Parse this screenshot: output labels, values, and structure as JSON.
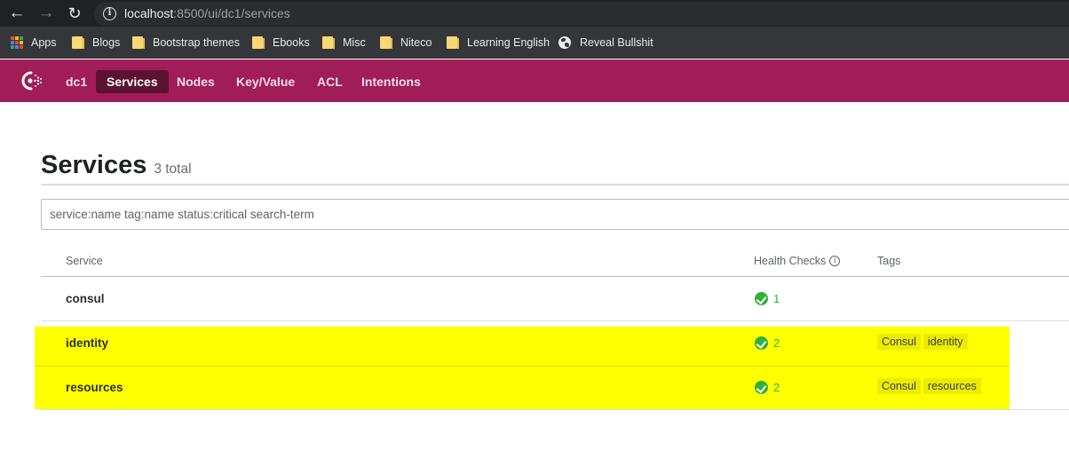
{
  "browser": {
    "url_host": "localhost",
    "url_rest": ":8500/ui/dc1/services",
    "bookmarks": [
      {
        "label": "Apps",
        "icon": "apps-grid-icon"
      },
      {
        "label": "Blogs",
        "icon": "folder-icon"
      },
      {
        "label": "Bootstrap themes",
        "icon": "folder-icon"
      },
      {
        "label": "Ebooks",
        "icon": "folder-icon"
      },
      {
        "label": "Misc",
        "icon": "folder-icon"
      },
      {
        "label": "Niteco",
        "icon": "folder-icon"
      },
      {
        "label": "Learning English",
        "icon": "folder-icon"
      },
      {
        "label": "Reveal Bullshit",
        "icon": "globe-icon"
      }
    ]
  },
  "header": {
    "brand_color": "#a01d58",
    "datacenter": "dc1",
    "nav": [
      {
        "label": "Services",
        "active": true
      },
      {
        "label": "Nodes",
        "active": false
      },
      {
        "label": "Key/Value",
        "active": false
      },
      {
        "label": "ACL",
        "active": false
      },
      {
        "label": "Intentions",
        "active": false
      }
    ]
  },
  "page": {
    "title": "Services",
    "count_label": "3 total",
    "search": {
      "value": "",
      "placeholder": "service:name tag:name status:critical search-term"
    }
  },
  "table": {
    "columns": [
      "Service",
      "Health Checks",
      "Tags"
    ],
    "rows": [
      {
        "service": "consul",
        "health_passing": "1",
        "tags": []
      },
      {
        "service": "identity",
        "health_passing": "2",
        "tags": [
          "Consul",
          "identity"
        ]
      },
      {
        "service": "resources",
        "health_passing": "2",
        "tags": [
          "Consul",
          "resources"
        ]
      }
    ]
  },
  "annotation": {
    "highlight_color": "#ffff00",
    "highlighted_rows": [
      "identity",
      "resources"
    ]
  }
}
